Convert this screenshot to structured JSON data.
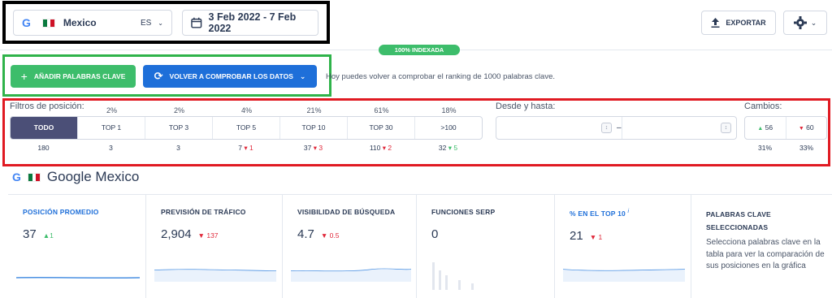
{
  "header": {
    "country": "Mexico",
    "language": "ES",
    "date_range": "3 Feb 2022 - 7 Feb 2022",
    "export_label": "EXPORTAR",
    "indexed_badge": "100% INDEXADA"
  },
  "actions": {
    "add_keywords_label": "AÑADIR PALABRAS CLAVE",
    "recheck_label": "VOLVER A COMPROBAR LOS DATOS",
    "hint_text": "Hoy puedes volver a comprobar el ranking de 1000 palabras clave."
  },
  "filters": {
    "title": "Filtros de posición:",
    "tabs": [
      "TODO",
      "TOP 1",
      "TOP 3",
      "TOP 5",
      "TOP 10",
      "TOP 30",
      ">100"
    ],
    "percents": [
      "2%",
      "2%",
      "4%",
      "21%",
      "61%",
      "18%"
    ],
    "counts": [
      "180",
      "3",
      "3",
      "7",
      "37",
      "110",
      "32"
    ],
    "deltas": [
      "",
      "",
      "",
      "1",
      "3",
      "2",
      "5"
    ],
    "range_label": "Desde y hasta:",
    "range_separator": "–",
    "changes_label": "Cambios:",
    "changes_up": "56",
    "changes_down": "60",
    "changes_up_pct": "31%",
    "changes_down_pct": "33%"
  },
  "engine": {
    "title": "Google Mexico"
  },
  "cards": [
    {
      "title": "POSICIÓN PROMEDIO",
      "value": "37",
      "delta": "1",
      "dir": "up"
    },
    {
      "title": "PREVISIÓN DE TRÁFICO",
      "value": "2,904",
      "delta": "137",
      "dir": "down"
    },
    {
      "title": "VISIBILIDAD DE BÚSQUEDA",
      "value": "4.7",
      "delta": "0.5",
      "dir": "down"
    },
    {
      "title": "FUNCIONES SERP",
      "value": "0",
      "delta": "",
      "dir": ""
    },
    {
      "title": "% EN EL TOP 10",
      "value": "21",
      "delta": "1",
      "dir": "down",
      "info": "i"
    },
    {
      "title": "PALABRAS CLAVE SELECCIONADAS",
      "description": "Selecciona palabras clave en la tabla para ver la comparación de sus posiciones en la gráfica"
    }
  ],
  "icons": {
    "google": "google-icon",
    "flag": "mexico-flag-icon",
    "calendar": "calendar-icon",
    "export": "export-icon",
    "gear": "gear-icon",
    "plus": "plus-icon",
    "refresh": "refresh-icon",
    "chevron": "chevron-down-icon"
  },
  "colors": {
    "accent_blue": "#1e6fd9",
    "accent_green": "#3dbd6b",
    "active_tab": "#4b4f77",
    "down_red": "#e0283a"
  }
}
